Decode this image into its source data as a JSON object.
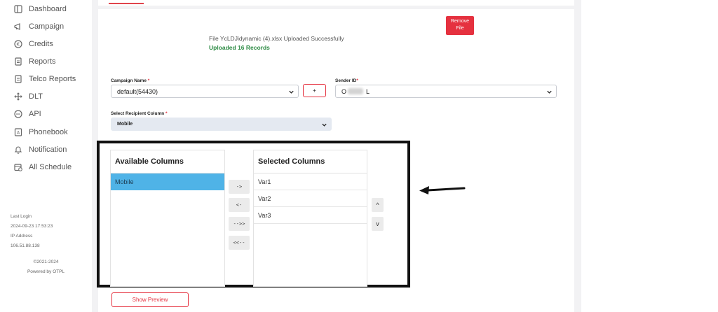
{
  "sidebar": {
    "items": [
      {
        "label": "Dashboard",
        "icon": "dashboard-icon"
      },
      {
        "label": "Campaign",
        "icon": "megaphone-icon"
      },
      {
        "label": "Credits",
        "icon": "credits-icon"
      },
      {
        "label": "Reports",
        "icon": "reports-icon"
      },
      {
        "label": "Telco Reports",
        "icon": "telco-reports-icon"
      },
      {
        "label": "DLT",
        "icon": "move-icon"
      },
      {
        "label": "API",
        "icon": "api-icon"
      },
      {
        "label": "Phonebook",
        "icon": "phonebook-icon"
      },
      {
        "label": "Notification",
        "icon": "bell-icon"
      },
      {
        "label": "All Schedule",
        "icon": "calendar-icon"
      }
    ],
    "last_login_label": "Last Login",
    "last_login_value": "2024-09-23 17:53:23",
    "ip_label": "IP Address",
    "ip_value": "106.51.88.138",
    "copyright": "©2021-2024",
    "powered_by": "Powered by OTPL"
  },
  "upload": {
    "remove_label_1": "Remove",
    "remove_label_2": "File",
    "file_message": "File YcLDJidynamic (4).xlsx Uploaded Successfully",
    "records_message": "Uploaded 16 Records"
  },
  "form": {
    "campaign_label": "Campaign Name",
    "campaign_value": "default(54430)",
    "plus_label": "+",
    "sender_label": "Sender ID",
    "sender_value_prefix": "O",
    "sender_value_suffix": "L",
    "recipient_label": "Select Recipient Column",
    "recipient_value": "Mobile",
    "required_mark": "*"
  },
  "columns": {
    "available_title": "Available Columns",
    "available_items": [
      "Mobile"
    ],
    "selected_title": "Selected Columns",
    "selected_items": [
      "Var1",
      "Var2",
      "Var3"
    ],
    "move_right": "->",
    "move_left": "<-",
    "move_all_right": "-->>",
    "move_all_left": "<<--",
    "order_up": "^",
    "order_down": "v"
  },
  "actions": {
    "show_preview": "Show Preview"
  },
  "colors": {
    "accent": "#e5313f",
    "success": "#2e8b45",
    "selected_item": "#4fb3e7"
  }
}
